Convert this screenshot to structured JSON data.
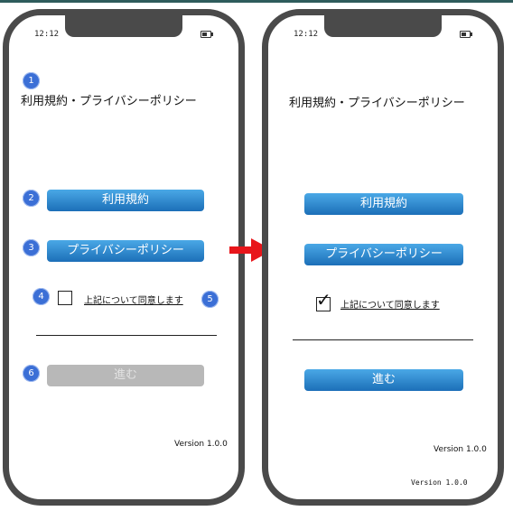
{
  "left": {
    "time": "12:12",
    "title": "利用規約・プライバシーポリシー",
    "terms_button": "利用規約",
    "privacy_button": "プライバシーポリシー",
    "agree_label": "上記について同意します",
    "agree_checked": false,
    "proceed_button": "進む",
    "proceed_enabled": false,
    "version": "Version  1.0.0",
    "badges": [
      "1",
      "2",
      "3",
      "4",
      "5",
      "6"
    ]
  },
  "right": {
    "time": "12:12",
    "title": "利用規約・プライバシーポリシー",
    "terms_button": "利用規約",
    "privacy_button": "プライバシーポリシー",
    "agree_label": "上記について同意します",
    "agree_checked": true,
    "check_mark": "✓",
    "proceed_button": "進む",
    "proceed_enabled": true,
    "version": "Version 1.0.0",
    "version_bottom": "Version  1.0.0"
  },
  "colors": {
    "button_blue": "#1c6fb8",
    "button_disabled": "#b8b8b8",
    "badge": "#3b6fd6",
    "arrow": "#e8161b",
    "phone_frame": "#4a4a4a"
  }
}
